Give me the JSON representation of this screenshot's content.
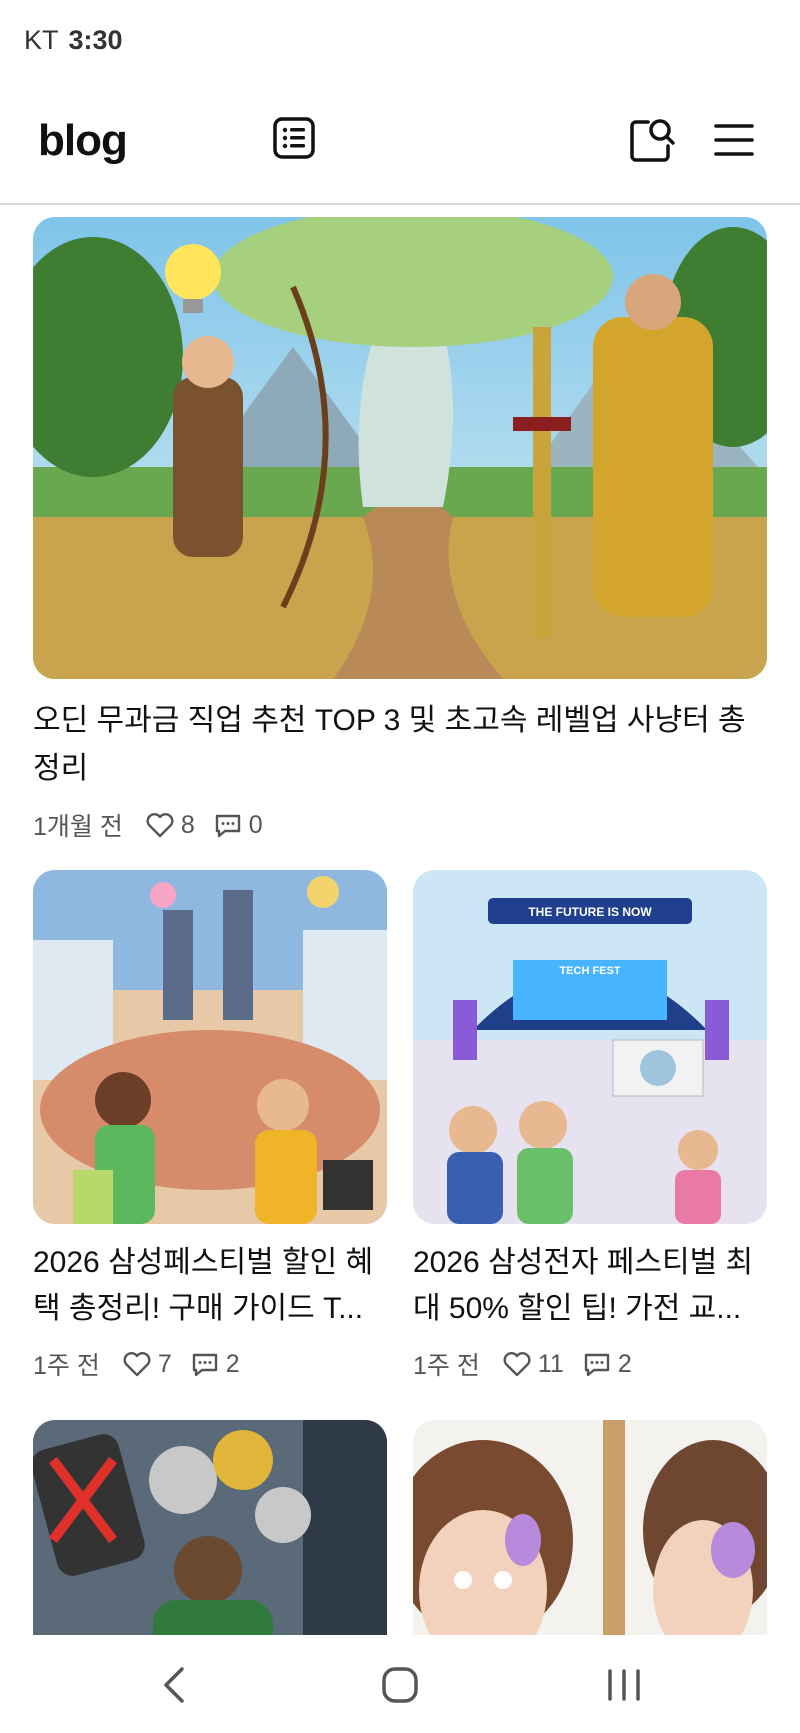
{
  "status": {
    "carrier": "KT",
    "time": "3:30"
  },
  "header": {
    "logo": "blog",
    "icons": [
      "list-icon",
      "search-icon",
      "hamburger-menu-icon"
    ]
  },
  "posts": [
    {
      "title": "오딘 무과금 직업 추천 TOP 3 및 초고속 레벨업 사냥터 총정리",
      "age": "1개월 전",
      "likes": "8",
      "comments": "0"
    },
    {
      "title": "2026 삼성페스티벌 할인 혜택 총정리! 구매 가이드 T...",
      "age": "1주 전",
      "likes": "7",
      "comments": "2"
    },
    {
      "title": "2026 삼성전자 페스티벌 최대 50% 할인 팁! 가전 교...",
      "age": "1주 전",
      "likes": "11",
      "comments": "2"
    },
    {
      "title": "",
      "age": "",
      "likes": "",
      "comments": ""
    },
    {
      "title": "",
      "age": "",
      "likes": "",
      "comments": ""
    }
  ],
  "thumbnail_texts": {
    "tech_fest_banner": "THE FUTURE IS NOW",
    "tech_fest_stage": "TECH FEST"
  },
  "nav": {
    "icons": [
      "back-icon",
      "home-icon",
      "recent-apps-icon"
    ]
  },
  "colors": {
    "text": "#111111",
    "meta": "#555555",
    "divider": "#d9d9d9",
    "background": "#ffffff"
  }
}
